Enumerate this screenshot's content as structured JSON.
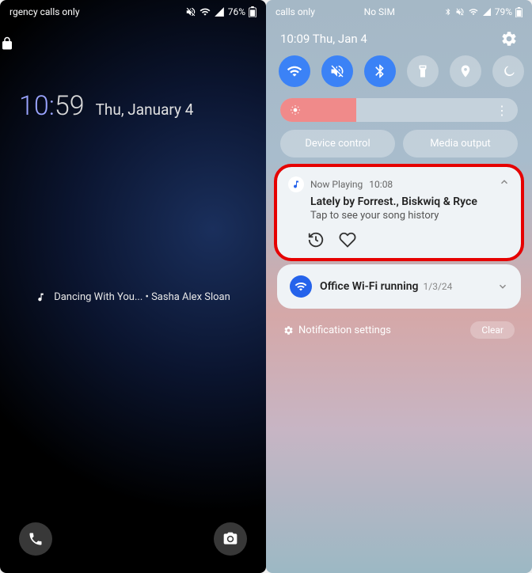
{
  "left": {
    "status": {
      "carrier": "rgency calls only",
      "battery": "76%"
    },
    "time_hour": "10:",
    "time_minute": "59",
    "date": "Thu, January 4",
    "now_playing": "Dancing With You... • Sasha Alex Sloan"
  },
  "right": {
    "status": {
      "carrier": "calls only",
      "sim": "No SIM",
      "battery": "79%"
    },
    "date_time": "10:09  Thu, Jan 4",
    "pills": {
      "device": "Device control",
      "media": "Media output"
    },
    "notif1": {
      "app": "Now Playing",
      "time": "10:08",
      "title": "Lately by Forrest., Biskwiq & Ryce",
      "sub": "Tap to see your song history"
    },
    "notif2": {
      "title": "Office Wi-Fi running",
      "date": "1/3/24"
    },
    "footer": {
      "settings": "Notification settings",
      "clear": "Clear"
    }
  }
}
